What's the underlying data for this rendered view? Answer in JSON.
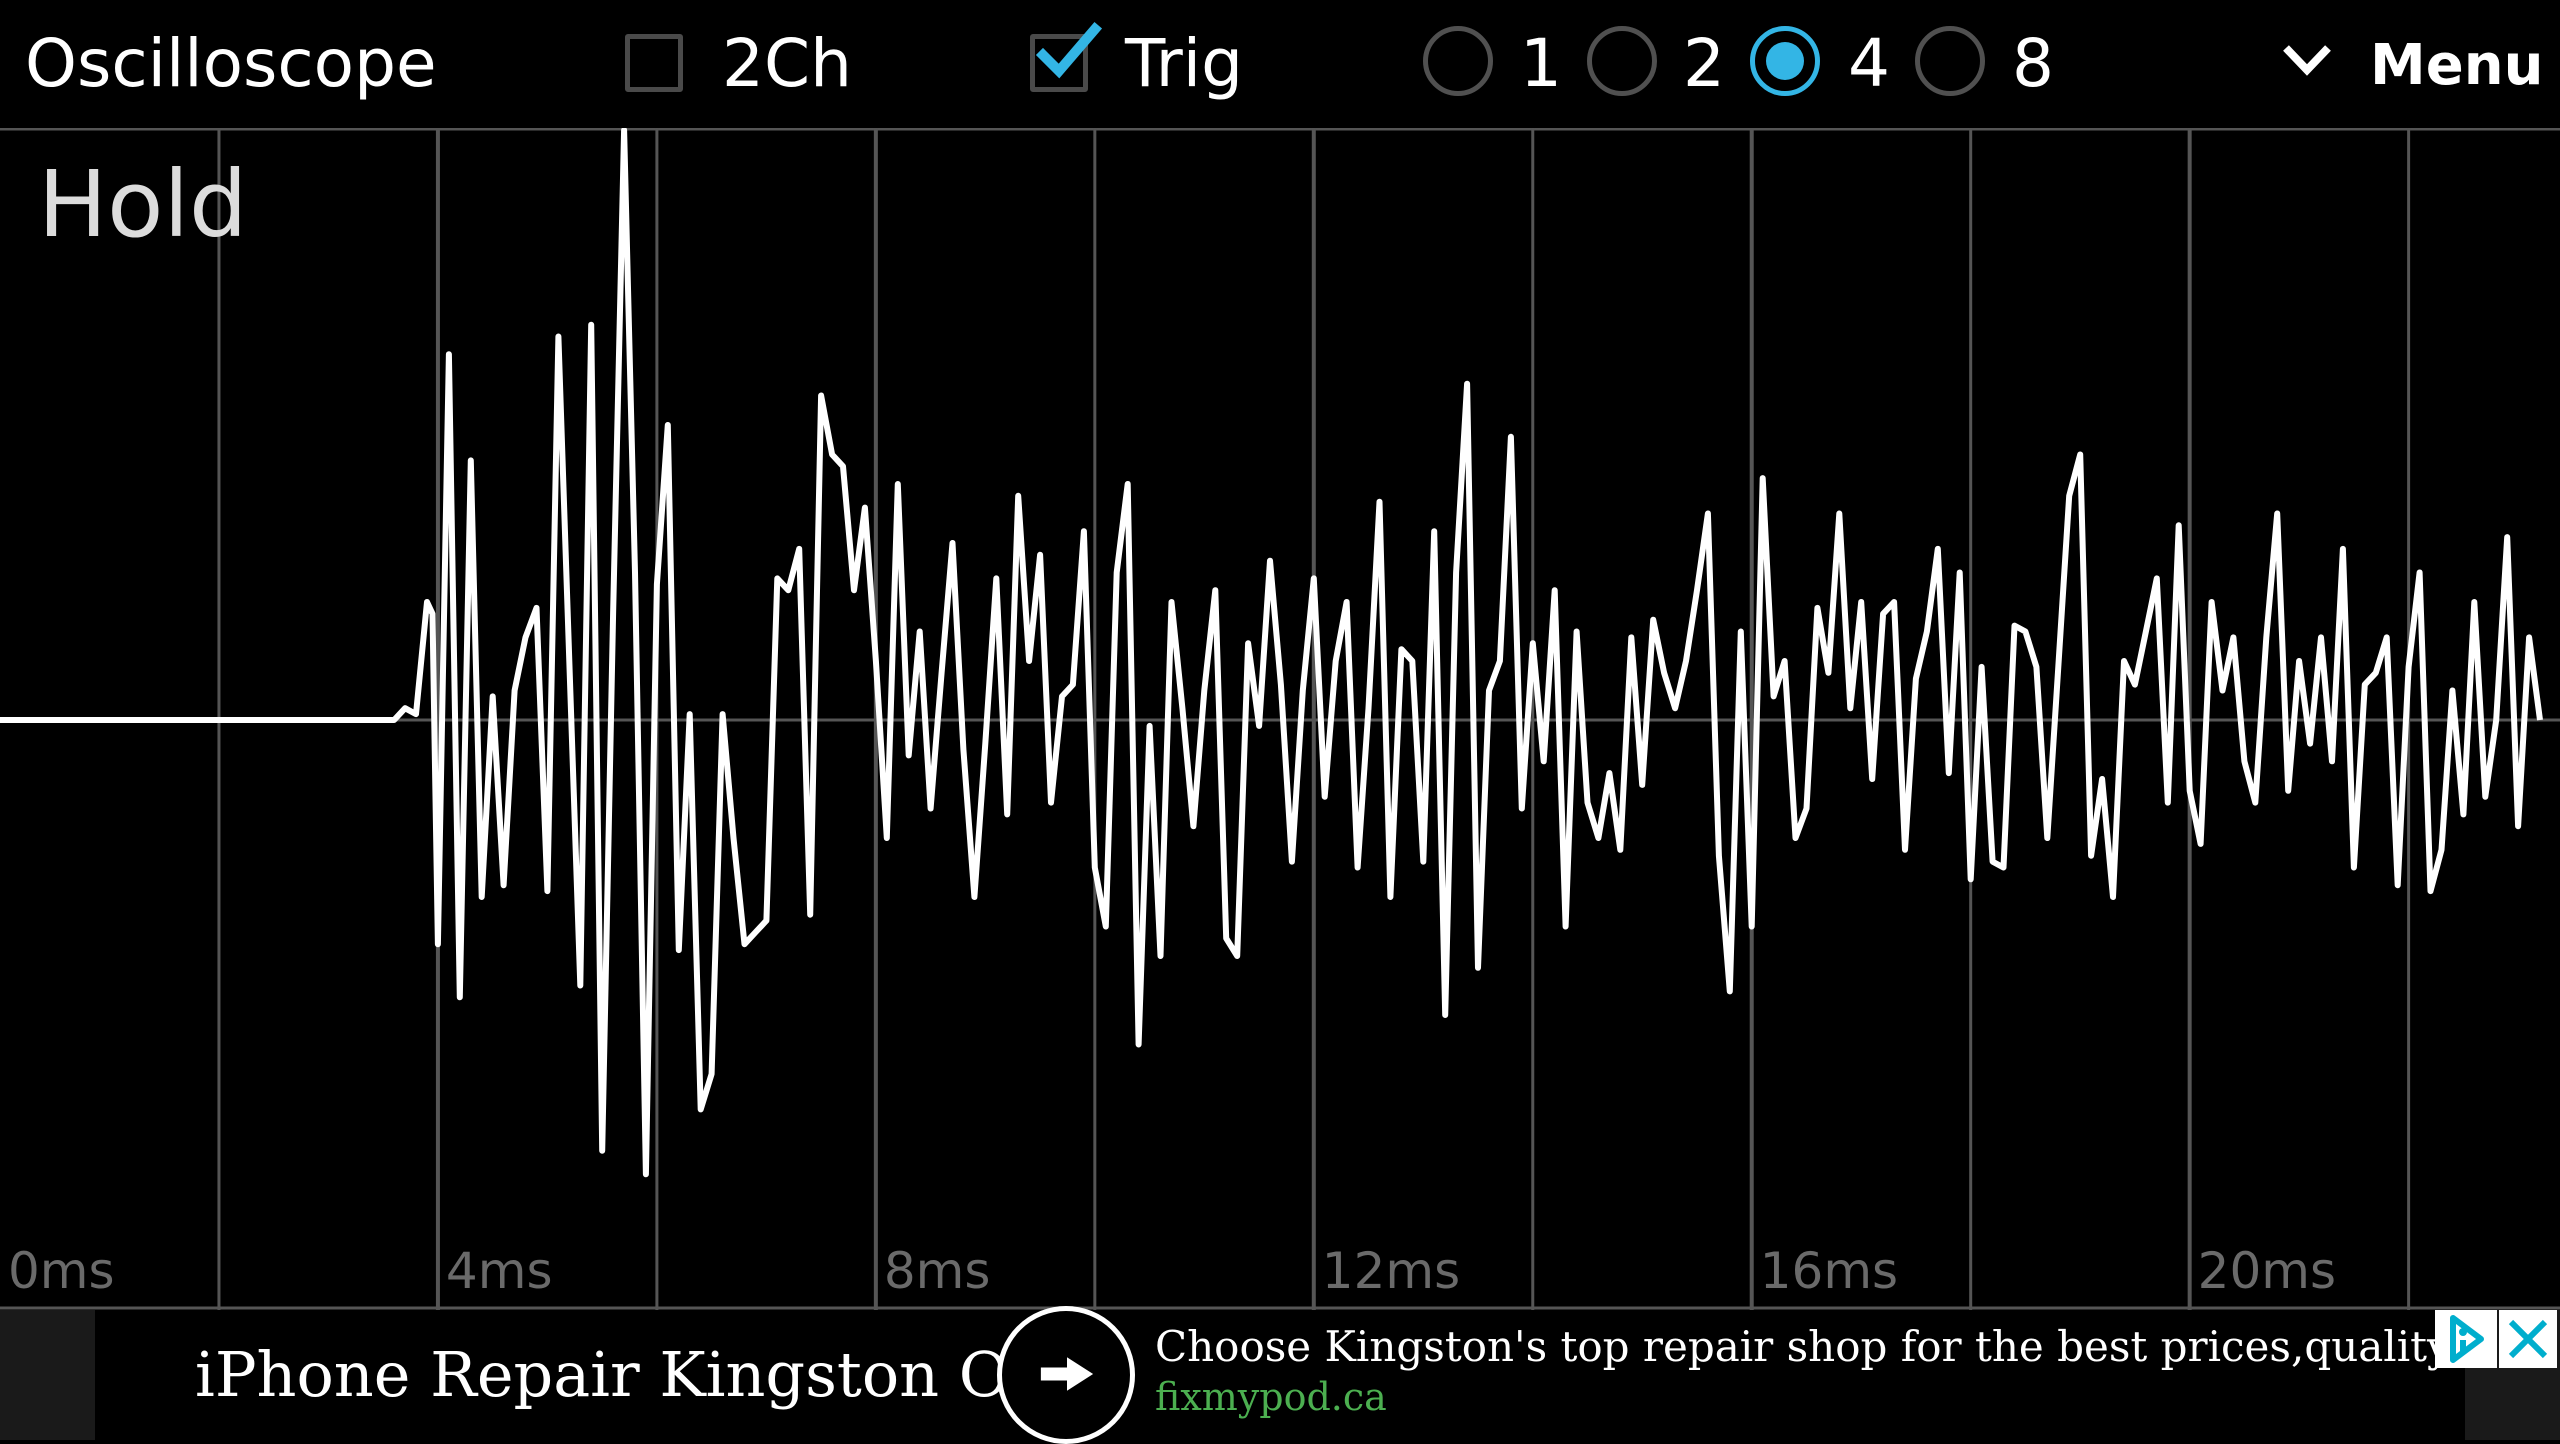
{
  "toolbar": {
    "title": "Oscilloscope",
    "two_channel": {
      "label": "2Ch",
      "checked": false
    },
    "trigger": {
      "label": "Trig",
      "checked": true
    },
    "timebase_options": [
      {
        "label": "1",
        "selected": false
      },
      {
        "label": "2",
        "selected": false
      },
      {
        "label": "4",
        "selected": true
      },
      {
        "label": "8",
        "selected": false
      }
    ],
    "menu_label": "Menu",
    "accent_color": "#33b5e5"
  },
  "scope": {
    "status": "Hold",
    "grid_color": "#555555",
    "trace_color": "#ffffff"
  },
  "chart_data": {
    "type": "line",
    "x_ticks": [
      "0ms",
      "4ms",
      "8ms",
      "12ms",
      "16ms",
      "20ms"
    ],
    "xlim": [
      0,
      23.2
    ],
    "ylim": [
      -1,
      1
    ],
    "grid": true,
    "series": [
      {
        "x": [
          0,
          0.2,
          0.4,
          0.6,
          0.8,
          1,
          1.2,
          1.4,
          1.6,
          1.8,
          2,
          2.2,
          2.4,
          2.6,
          2.8,
          3,
          3.2,
          3.4,
          3.6,
          3.7,
          3.8,
          3.9,
          3.95,
          4,
          4.1,
          4.2,
          4.3,
          4.4,
          4.5,
          4.6,
          4.7,
          4.8,
          4.9,
          5,
          5.1,
          5.2,
          5.3,
          5.4,
          5.5,
          5.6,
          5.7,
          5.8,
          5.9,
          6,
          6.1,
          6.2,
          6.3,
          6.4,
          6.5,
          6.6,
          6.7,
          6.8,
          6.9,
          7,
          7.1,
          7.2,
          7.3,
          7.4,
          7.5,
          7.6,
          7.7,
          7.8,
          7.9,
          8,
          8.1,
          8.2,
          8.3,
          8.4,
          8.5,
          8.6,
          8.7,
          8.8,
          8.9,
          9,
          9.1,
          9.2,
          9.3,
          9.4,
          9.5,
          9.6,
          9.7,
          9.8,
          9.9,
          10,
          10.1,
          10.2,
          10.3,
          10.4,
          10.5,
          10.6,
          10.7,
          10.8,
          10.9,
          11,
          11.1,
          11.2,
          11.3,
          11.4,
          11.5,
          11.6,
          11.7,
          11.8,
          11.9,
          12,
          12.1,
          12.2,
          12.3,
          12.4,
          12.5,
          12.6,
          12.7,
          12.8,
          12.9,
          13,
          13.1,
          13.2,
          13.3,
          13.4,
          13.5,
          13.6,
          13.7,
          13.8,
          13.9,
          14,
          14.1,
          14.2,
          14.3,
          14.4,
          14.5,
          14.6,
          14.7,
          14.8,
          14.9,
          15,
          15.1,
          15.2,
          15.3,
          15.4,
          15.5,
          15.6,
          15.7,
          15.8,
          15.9,
          16,
          16.1,
          16.2,
          16.3,
          16.4,
          16.5,
          16.6,
          16.7,
          16.8,
          16.9,
          17,
          17.1,
          17.2,
          17.3,
          17.4,
          17.5,
          17.6,
          17.7,
          17.8,
          17.9,
          18,
          18.1,
          18.2,
          18.3,
          18.4,
          18.5,
          18.6,
          18.7,
          18.8,
          18.9,
          19,
          19.1,
          19.2,
          19.3,
          19.4,
          19.5,
          19.6,
          19.7,
          19.8,
          19.9,
          20,
          20.1,
          20.2,
          20.3,
          20.4,
          20.5,
          20.6,
          20.7,
          20.8,
          20.9,
          21,
          21.1,
          21.2,
          21.3,
          21.4,
          21.5,
          21.6,
          21.7,
          21.8,
          21.9,
          22,
          22.1,
          22.2,
          22.3,
          22.4,
          22.5,
          22.6,
          22.7,
          22.8,
          22.9,
          23,
          23.1,
          23.2
        ],
        "y": [
          0,
          0,
          0,
          0,
          0,
          0,
          0,
          0,
          0,
          0,
          0,
          0,
          0,
          0,
          0,
          0,
          0,
          0,
          0,
          0.02,
          0.01,
          0.2,
          0.18,
          -0.38,
          0.62,
          -0.47,
          0.44,
          -0.3,
          0.04,
          -0.28,
          0.05,
          0.14,
          0.19,
          -0.29,
          0.65,
          0.1,
          -0.45,
          0.67,
          -0.73,
          0.18,
          1,
          0.25,
          -0.77,
          0.23,
          0.5,
          -0.39,
          0.01,
          -0.66,
          -0.6,
          0.01,
          -0.2,
          -0.38,
          -0.36,
          -0.34,
          0.24,
          0.22,
          0.29,
          -0.33,
          0.55,
          0.45,
          0.43,
          0.22,
          0.36,
          0.1,
          -0.2,
          0.4,
          -0.06,
          0.15,
          -0.15,
          0.08,
          0.3,
          -0.05,
          -0.3,
          -0.04,
          0.24,
          -0.16,
          0.38,
          0.1,
          0.28,
          -0.14,
          0.04,
          0.06,
          0.32,
          -0.25,
          -0.35,
          0.25,
          0.4,
          -0.55,
          -0.01,
          -0.4,
          0.2,
          0.02,
          -0.18,
          0.05,
          0.22,
          -0.37,
          -0.4,
          0.13,
          -0.01,
          0.27,
          0.06,
          -0.24,
          0.05,
          0.24,
          -0.13,
          0.1,
          0.2,
          -0.25,
          0.02,
          0.37,
          -0.3,
          0.12,
          0.1,
          -0.24,
          0.32,
          -0.5,
          0.25,
          0.57,
          -0.42,
          0.05,
          0.1,
          0.48,
          -0.15,
          0.13,
          -0.07,
          0.22,
          -0.35,
          0.15,
          -0.14,
          -0.2,
          -0.09,
          -0.22,
          0.14,
          -0.11,
          0.17,
          0.08,
          0.02,
          0.1,
          0.22,
          0.35,
          -0.23,
          -0.46,
          0.15,
          -0.35,
          0.41,
          0.04,
          0.1,
          -0.2,
          -0.15,
          0.19,
          0.08,
          0.35,
          0.02,
          0.2,
          -0.1,
          0.18,
          0.2,
          -0.22,
          0.07,
          0.15,
          0.29,
          -0.09,
          0.25,
          -0.27,
          0.09,
          -0.24,
          -0.25,
          0.16,
          0.15,
          0.09,
          -0.2,
          0.09,
          0.38,
          0.45,
          -0.23,
          -0.1,
          -0.3,
          0.1,
          0.06,
          0.15,
          0.24,
          -0.14,
          0.33,
          -0.12,
          -0.21,
          0.2,
          0.05,
          0.14,
          -0.07,
          -0.14,
          0.14,
          0.35,
          -0.12,
          0.1,
          -0.04,
          0.14,
          -0.07,
          0.29,
          -0.25,
          0.06,
          0.08,
          0.14,
          -0.28,
          0.09,
          0.25,
          -0.29,
          -0.22,
          0.05,
          -0.16,
          0.2,
          -0.13,
          0,
          0.31,
          -0.18,
          0.14,
          0
        ]
      }
    ]
  },
  "ad": {
    "title": "iPhone Repair Kingston ON",
    "description": "Choose Kingston's top repair shop for the best prices,quality & speed",
    "url": "fixmypod.ca",
    "action_icon": "arrow-right-icon",
    "choices_icon": "ad-choices-icon",
    "close_icon": "close-icon",
    "link_color": "#4caf50",
    "choices_color": "#00aecd"
  }
}
